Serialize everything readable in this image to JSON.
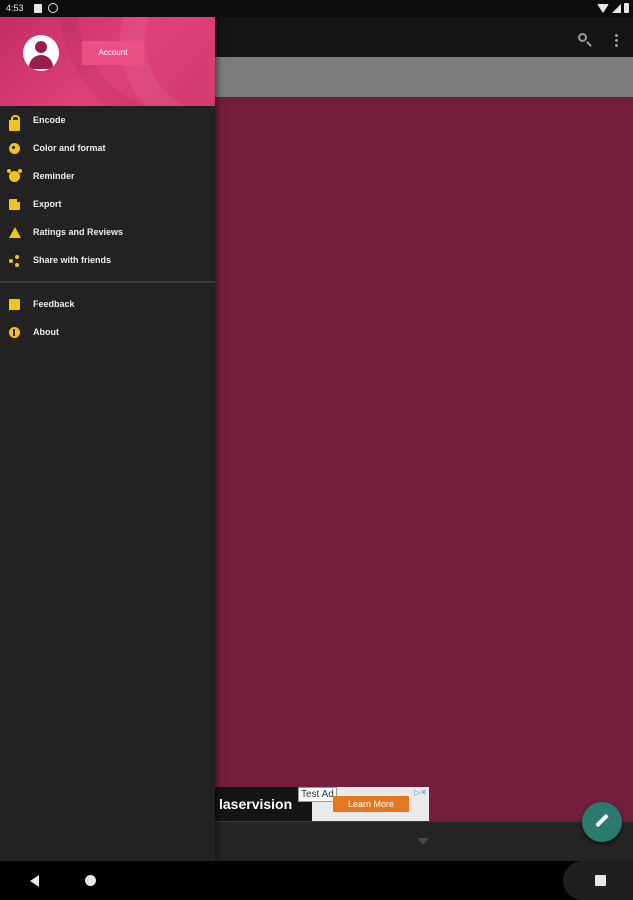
{
  "status_bar": {
    "time": "4:53"
  },
  "app_bar": {
    "actions": [
      "search-icon",
      "more-vert-icon"
    ]
  },
  "drawer": {
    "account_button": "Account",
    "menu": [
      {
        "label": "Encode",
        "icon": "lock-icon"
      },
      {
        "label": "Color and format",
        "icon": "palette-icon"
      },
      {
        "label": "Reminder",
        "icon": "alarm-icon"
      },
      {
        "label": "Export",
        "icon": "file-icon"
      },
      {
        "label": "Ratings and Reviews",
        "icon": "star-icon"
      },
      {
        "label": "Share with friends",
        "icon": "share-icon"
      }
    ],
    "secondary_menu": [
      {
        "label": "Feedback",
        "icon": "feedback-icon"
      },
      {
        "label": "About",
        "icon": "info-icon"
      }
    ]
  },
  "ad": {
    "brand": "laservision",
    "tag": "Test Ad",
    "cta": "Learn More"
  },
  "colors": {
    "content_background": "#731e3c",
    "drawer_header": "#e0407a",
    "accent_icons": "#f2c418",
    "fab": "#2a7a6e"
  }
}
